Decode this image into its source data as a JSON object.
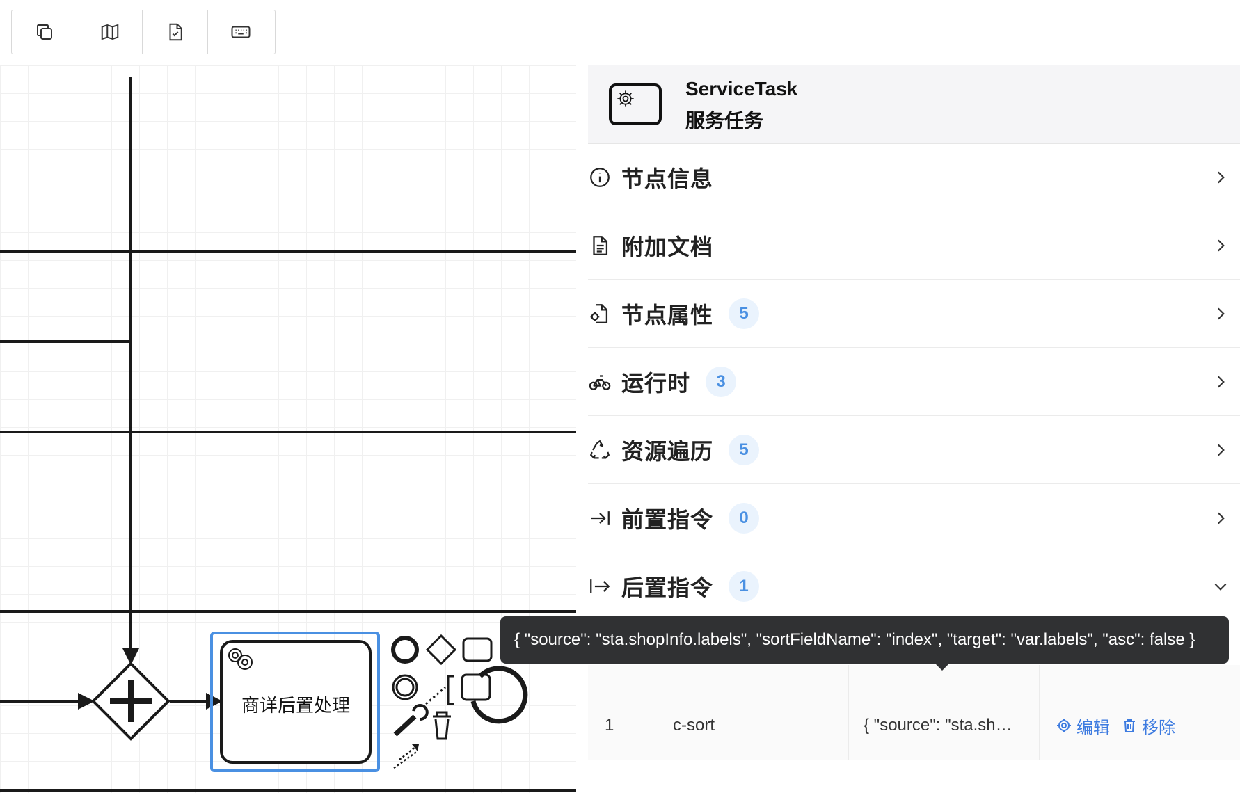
{
  "toolbar": {
    "buttons": [
      {
        "icon": "copy-icon"
      },
      {
        "icon": "map-icon"
      },
      {
        "icon": "file-check-icon"
      },
      {
        "icon": "keyboard-icon"
      }
    ]
  },
  "diagram": {
    "task_label": "商详后置处理",
    "selection_color": "#4a90e2"
  },
  "panel": {
    "header": {
      "type": "ServiceTask",
      "name": "服务任务"
    },
    "sections": [
      {
        "label": "节点信息",
        "icon": "info-icon",
        "badge": null,
        "expanded": false
      },
      {
        "label": "附加文档",
        "icon": "document-icon",
        "badge": null,
        "expanded": false
      },
      {
        "label": "节点属性",
        "icon": "file-gear-icon",
        "badge": "5",
        "expanded": false
      },
      {
        "label": "运行时",
        "icon": "bike-icon",
        "badge": "3",
        "expanded": false
      },
      {
        "label": "资源遍历",
        "icon": "recycle-icon",
        "badge": "5",
        "expanded": false
      },
      {
        "label": "前置指令",
        "icon": "arrow-to-line-icon",
        "badge": "0",
        "expanded": false
      },
      {
        "label": "后置指令",
        "icon": "arrow-from-line-icon",
        "badge": "1",
        "expanded": true
      }
    ],
    "table": {
      "rows": [
        {
          "index": "1",
          "name": "c-sort",
          "params": "{ \"source\": \"sta.sh…",
          "edit_label": "编辑",
          "remove_label": "移除"
        }
      ]
    },
    "tooltip": "{ \"source\": \"sta.shopInfo.labels\", \"sortFieldName\": \"index\", \"target\": \"var.labels\", \"asc\": false }"
  },
  "colors": {
    "accent": "#4a90e2",
    "link": "#3d7be0",
    "tooltip_bg": "#303133",
    "badge_bg": "#eaf3fd"
  }
}
